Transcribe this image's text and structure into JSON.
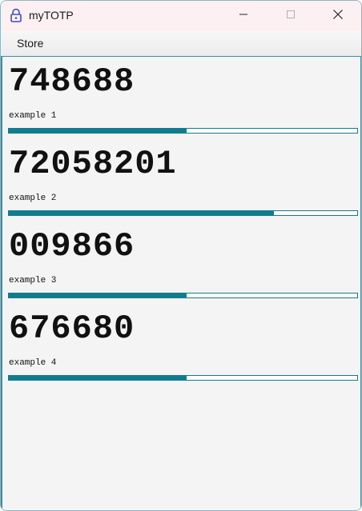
{
  "window": {
    "title": "myTOTP",
    "icon": "lock-icon"
  },
  "menu": {
    "items": [
      "Store"
    ]
  },
  "entries": [
    {
      "code": "748688",
      "name": "example 1",
      "progress": 0.51
    },
    {
      "code": "72058201",
      "name": "example 2",
      "progress": 0.76
    },
    {
      "code": "009866",
      "name": "example 3",
      "progress": 0.51
    },
    {
      "code": "676680",
      "name": "example 4",
      "progress": 0.51
    }
  ],
  "colors": {
    "accent": "#127c8f",
    "titlebar": "#fdf0f2",
    "background": "#f4f4f4"
  }
}
